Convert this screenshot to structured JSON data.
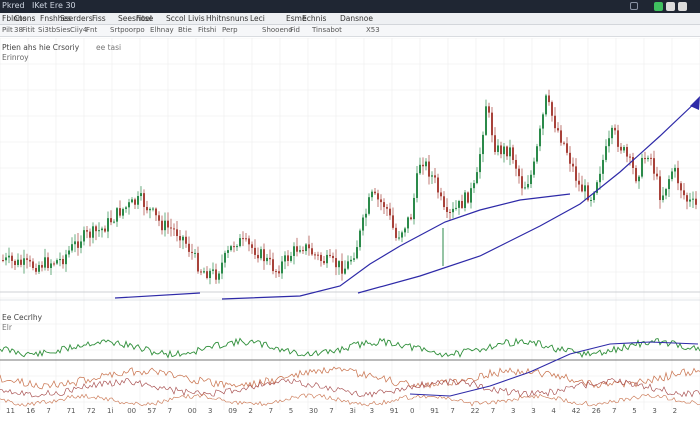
{
  "window": {
    "title": "Pkred",
    "title_tail": "IKet  Ere  30",
    "btn_colors": [
      "#3fbf5f",
      "#dcdcdc",
      "#dcdcdc"
    ]
  },
  "menu": [
    "Fblnns",
    "Ctons",
    "Fnshhes",
    "Sserders",
    "Fiss",
    "Seesnoel",
    "Fitse",
    "Sccol",
    "Livis",
    "Hhitnsnuns",
    "Leci",
    "Esme",
    "Echnis",
    "Dansnoe"
  ],
  "toolbar": [
    "Pilt",
    "38",
    "Fitit",
    "Si3tb",
    "Sies",
    "Ciiy4",
    "Fnt",
    "Srtpoorpo",
    "Elhnay",
    "Btie",
    "Fitshi",
    "Perp",
    "Shooeno",
    "Fid",
    "Tinsabot",
    "X53"
  ],
  "chart": {
    "symbol": "Ptien ahs hie Crsoriy",
    "symbol_tail": "ee tasi",
    "subtitle": "Erinroy",
    "indicator": "Ee Cecrlhy",
    "indicator_sub": "Elr",
    "x_ticks": [
      "11",
      "16",
      "7",
      "71",
      "72",
      "1i",
      "00",
      "57",
      "7",
      "00",
      "3",
      "09",
      "2",
      "7",
      "5",
      "30",
      "7",
      "3i",
      "3",
      "91",
      "0",
      "91",
      "7",
      "22",
      "7",
      "3",
      "3",
      "4",
      "42",
      "26",
      "7",
      "5",
      "3",
      "2"
    ],
    "colors": {
      "up": "#2b8a4a",
      "down": "#a8423a",
      "ma": "#2e2aa8",
      "osc_green": "#2f8f3a",
      "osc_orange": "#c8704a",
      "osc_red": "#a04040",
      "grid": "#ececec",
      "zero": "#4a4a4a"
    }
  }
}
